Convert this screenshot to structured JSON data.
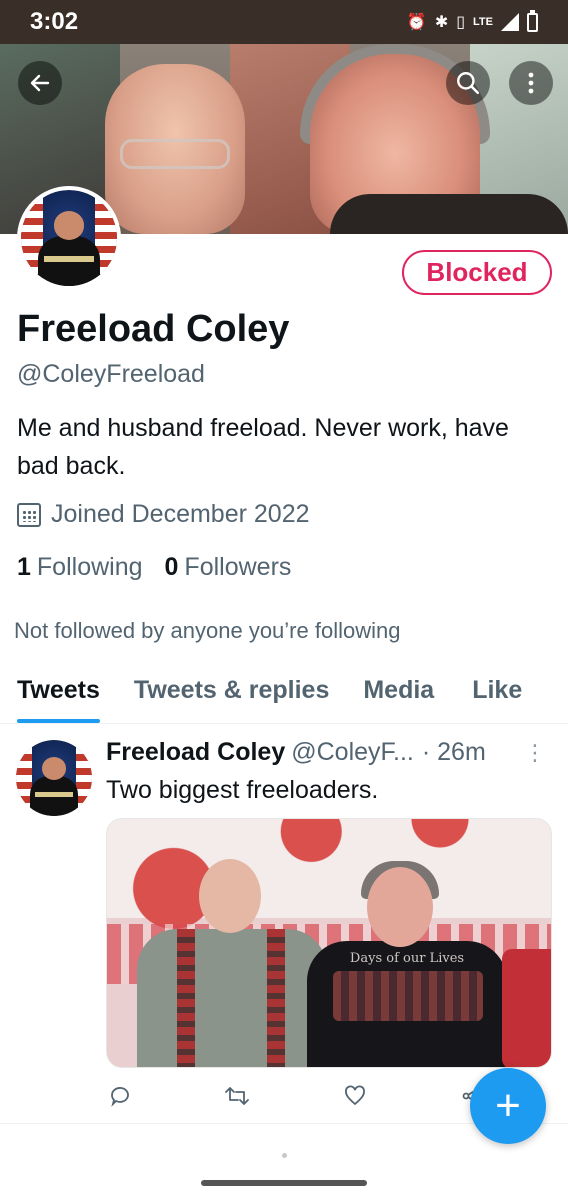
{
  "status_bar": {
    "time": "3:02",
    "network": "LTE",
    "icons": [
      "alarm-icon",
      "bluetooth-icon",
      "vibrate-icon",
      "signal-icon",
      "battery-icon"
    ]
  },
  "header": {
    "back_icon": "back-arrow-icon",
    "search_icon": "search-icon",
    "more_icon": "more-vertical-icon"
  },
  "profile": {
    "name": "Freeload Coley",
    "handle": "@ColeyFreeload",
    "bio": "Me and husband freeload. Never work, have bad back.",
    "joined": "Joined December 2022",
    "following_count": "1",
    "following_label": "Following",
    "followers_count": "0",
    "followers_label": "Followers",
    "not_followed": "Not followed by anyone you’re following",
    "blocked_label": "Blocked"
  },
  "tabs": [
    {
      "label": "Tweets",
      "active": true
    },
    {
      "label": "Tweets & replies",
      "active": false
    },
    {
      "label": "Media",
      "active": false
    },
    {
      "label": "Like",
      "active": false
    }
  ],
  "tweet": {
    "author_name": "Freeload Coley",
    "author_handle": "@ColeyF...",
    "time": "· 26m",
    "text": "Two biggest freeloaders.",
    "image_text": "Days of our Lives"
  },
  "fab": {
    "label": "+"
  },
  "colors": {
    "accent": "#1d9bf0",
    "blocked": "#e0245e",
    "secondary_text": "#536471"
  }
}
